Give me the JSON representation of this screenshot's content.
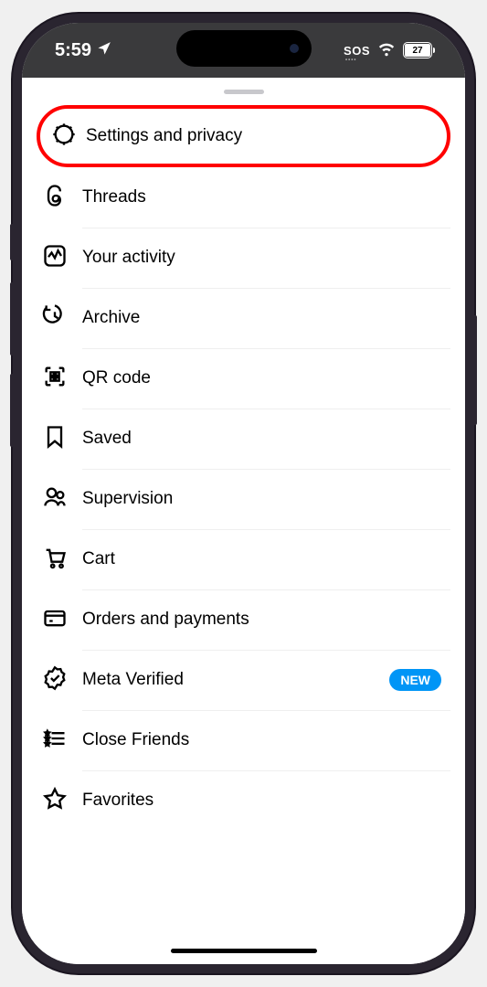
{
  "status": {
    "time": "5:59",
    "sos": "SOS",
    "battery_pct": "27"
  },
  "menu": {
    "items": [
      {
        "label": "Settings and privacy",
        "badge": null,
        "highlighted": true
      },
      {
        "label": "Threads",
        "badge": null
      },
      {
        "label": "Your activity",
        "badge": null
      },
      {
        "label": "Archive",
        "badge": null
      },
      {
        "label": "QR code",
        "badge": null
      },
      {
        "label": "Saved",
        "badge": null
      },
      {
        "label": "Supervision",
        "badge": null
      },
      {
        "label": "Cart",
        "badge": null
      },
      {
        "label": "Orders and payments",
        "badge": null
      },
      {
        "label": "Meta Verified",
        "badge": "NEW"
      },
      {
        "label": "Close Friends",
        "badge": null
      },
      {
        "label": "Favorites",
        "badge": null
      }
    ]
  }
}
